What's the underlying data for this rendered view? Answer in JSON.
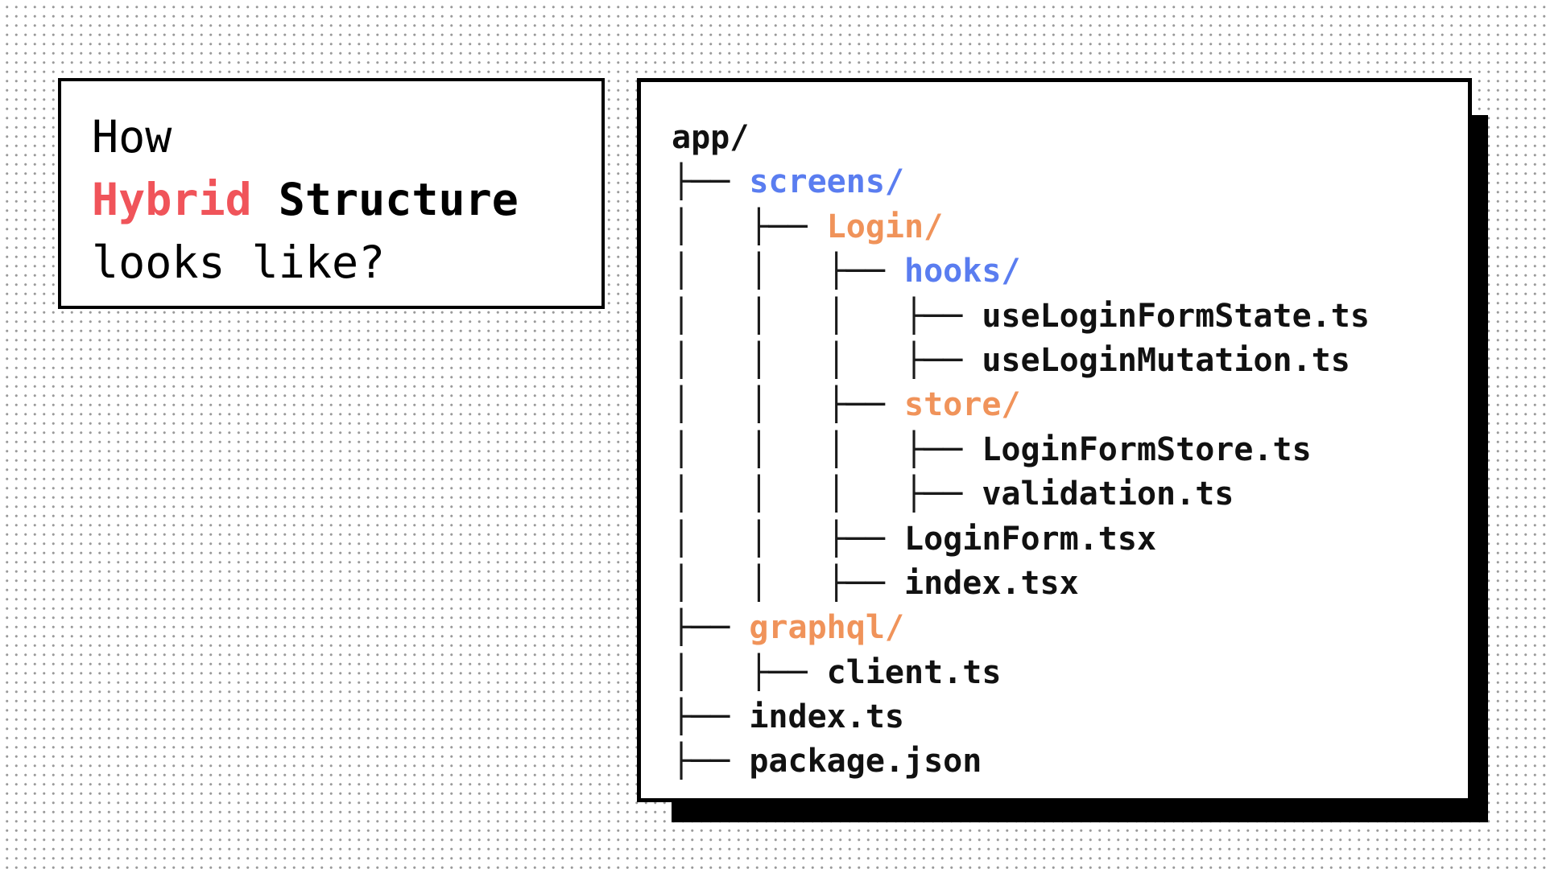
{
  "colors": {
    "text": "#111111",
    "highlight_red": "#f0545a",
    "folder_blue": "#5a7df0",
    "folder_orange": "#f0935a"
  },
  "title": {
    "line1": "How",
    "line2_highlight": "Hybrid",
    "line2_rest": " Structure",
    "line3": "looks like?"
  },
  "tree": [
    {
      "prefix": "",
      "name": "app/",
      "kind": "root"
    },
    {
      "prefix": "├── ",
      "name": "screens/",
      "kind": "blue"
    },
    {
      "prefix": "│   ├── ",
      "name": "Login/",
      "kind": "orange"
    },
    {
      "prefix": "│   │   ├── ",
      "name": "hooks/",
      "kind": "blue"
    },
    {
      "prefix": "│   │   │   ├── ",
      "name": "useLoginFormState.ts",
      "kind": "file"
    },
    {
      "prefix": "│   │   │   ├── ",
      "name": "useLoginMutation.ts",
      "kind": "file"
    },
    {
      "prefix": "│   │   ├── ",
      "name": "store/",
      "kind": "orange"
    },
    {
      "prefix": "│   │   │   ├── ",
      "name": "LoginFormStore.ts",
      "kind": "file"
    },
    {
      "prefix": "│   │   │   ├── ",
      "name": "validation.ts",
      "kind": "file"
    },
    {
      "prefix": "│   │   ├── ",
      "name": "LoginForm.tsx",
      "kind": "file"
    },
    {
      "prefix": "│   │   ├── ",
      "name": "index.tsx",
      "kind": "file"
    },
    {
      "prefix": "├── ",
      "name": "graphql/",
      "kind": "orange"
    },
    {
      "prefix": "│   ├── ",
      "name": "client.ts",
      "kind": "file"
    },
    {
      "prefix": "├── ",
      "name": "index.ts",
      "kind": "file"
    },
    {
      "prefix": "├── ",
      "name": "package.json",
      "kind": "file"
    }
  ]
}
